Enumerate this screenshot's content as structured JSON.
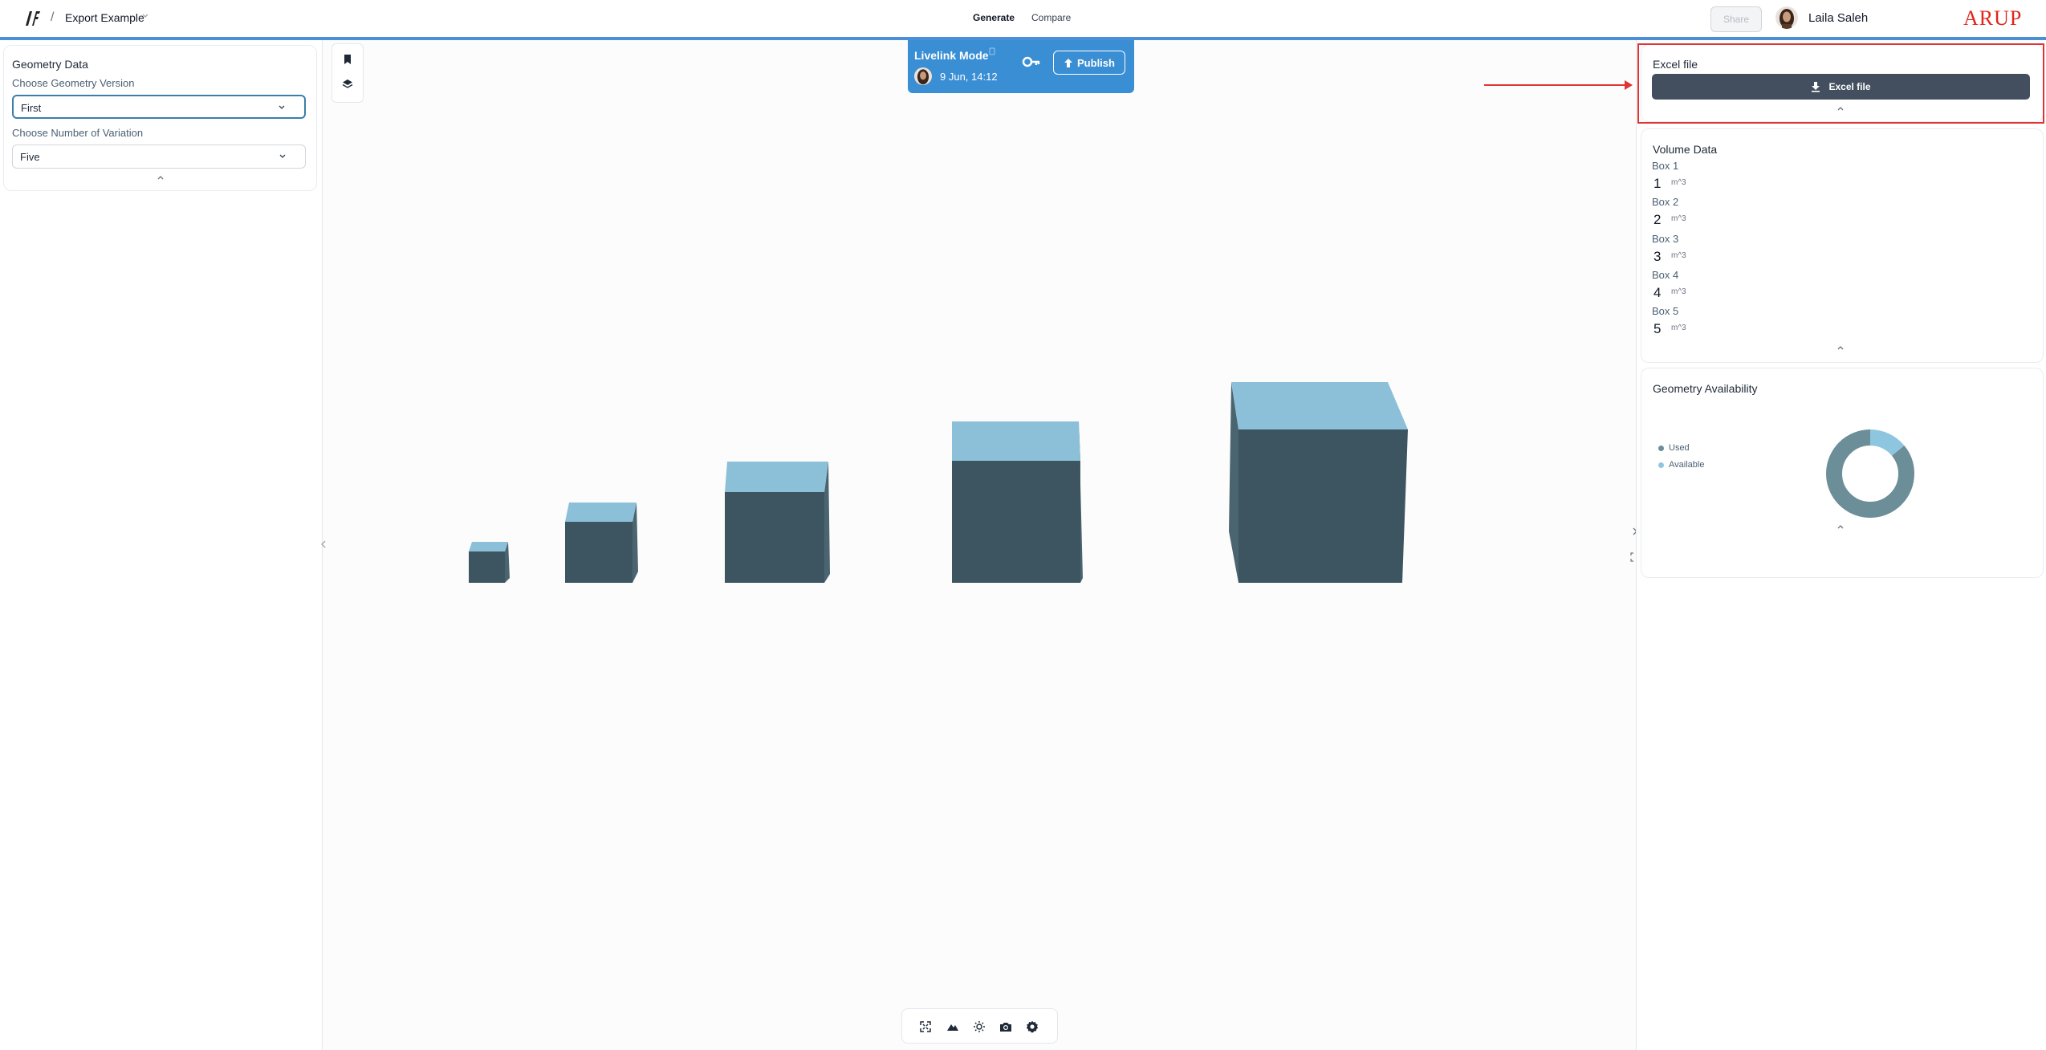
{
  "header": {
    "project_name": "Export Example",
    "crumb_separator": "/",
    "tabs": [
      {
        "label": "Generate",
        "active": true
      },
      {
        "label": "Compare",
        "active": false
      }
    ],
    "share_label": "Share",
    "user_name": "Laila Saleh",
    "brand": "ARUP"
  },
  "livelink": {
    "title": "Livelink Mode",
    "date": "9 Jun, 14:12",
    "publish_label": "Publish"
  },
  "left_panel": {
    "title": "Geometry Data",
    "fields": [
      {
        "label": "Choose Geometry Version",
        "value": "First"
      },
      {
        "label": "Choose Number of Variation",
        "value": "Five"
      }
    ]
  },
  "right_panel": {
    "excel": {
      "title": "Excel file",
      "button_label": "Excel file"
    },
    "volume": {
      "title": "Volume Data",
      "items": [
        {
          "label": "Box 1",
          "value": "1",
          "unit": "m^3"
        },
        {
          "label": "Box 2",
          "value": "2",
          "unit": "m^3"
        },
        {
          "label": "Box 3",
          "value": "3",
          "unit": "m^3"
        },
        {
          "label": "Box 4",
          "value": "4",
          "unit": "m^3"
        },
        {
          "label": "Box 5",
          "value": "5",
          "unit": "m^3"
        }
      ]
    },
    "availability": {
      "title": "Geometry Availability",
      "legend": [
        {
          "label": "Used",
          "color": "#6b8e98"
        },
        {
          "label": "Available",
          "color": "#8ec6df"
        }
      ],
      "used_fraction": 0.86
    }
  },
  "colors": {
    "accent": "#3a8ed4",
    "box_top": "#8cc0d8",
    "box_front": "#3d5561",
    "box_side": "#4b6570",
    "highlight": "#e03434"
  },
  "icons": {
    "logo": "app-logo-icon",
    "bookmark": "bookmark-icon",
    "layers": "layers-icon",
    "key": "key-icon",
    "upload": "upload-icon",
    "download": "download-icon",
    "toolbar": [
      "fullscreen-icon",
      "terrain-icon",
      "sun-icon",
      "camera-icon",
      "gear-icon"
    ]
  }
}
